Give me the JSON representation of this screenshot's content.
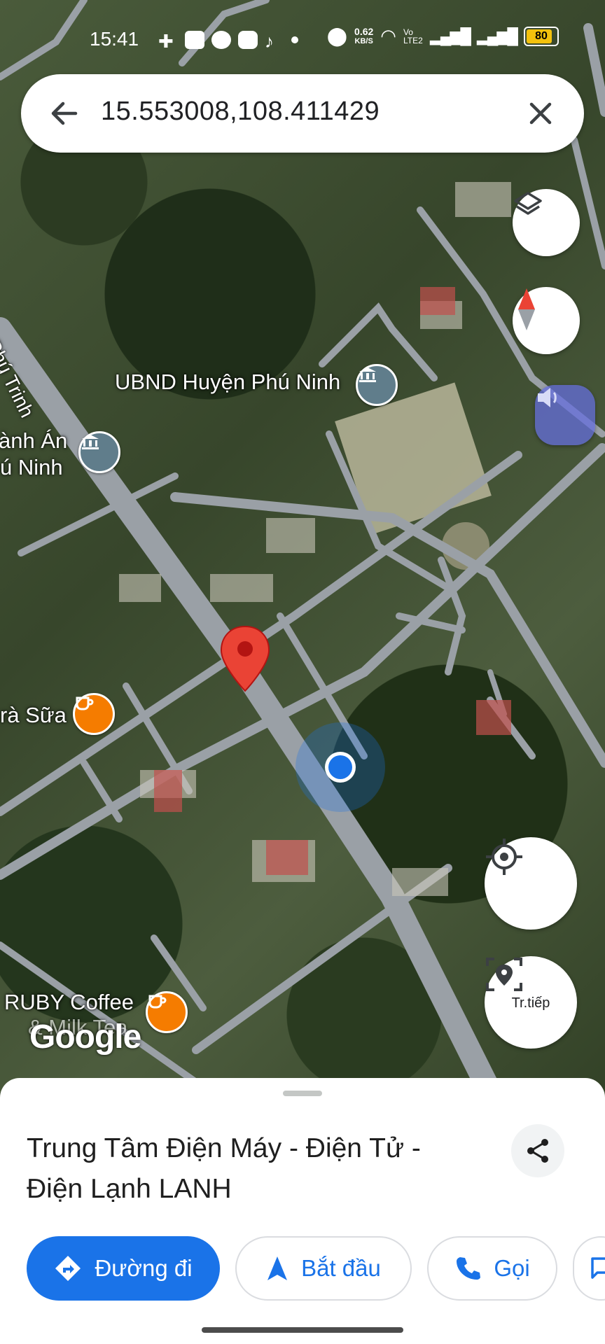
{
  "status_bar": {
    "time": "15:41",
    "network_speed": "0.62",
    "network_unit": "KB/S",
    "volte_label": "Vo LTE2",
    "battery": "80"
  },
  "search": {
    "value": "15.553008,108.411429"
  },
  "map": {
    "labels": {
      "ubnd": "UBND Huyện Phú Ninh",
      "left_top": "ành Án",
      "left_bottom": "ú Ninh",
      "road_name": "Phú Trinh",
      "tra_sua": "rà Sữa",
      "ruby_line1": "RUBY Coffee",
      "ruby_line2": "& Milk Tea"
    },
    "google_logo": "Google",
    "live_view_label": "Tr.tiếp",
    "colors": {
      "pin_red": "#ea4335",
      "location_blue": "#1a73e8",
      "road_gray": "#9aa0a6"
    }
  },
  "place": {
    "name": "Trung Tâm Điện Máy - Điện Tử - Điện Lạnh LANH"
  },
  "actions": {
    "directions": "Đường đi",
    "start": "Bắt đầu",
    "call": "Gọi"
  },
  "icons": [
    "back-arrow-icon",
    "close-icon",
    "layers-icon",
    "compass-icon",
    "volume-icon",
    "my-location-icon",
    "live-view-icon",
    "share-icon",
    "directions-icon",
    "navigation-icon",
    "phone-icon",
    "message-icon"
  ]
}
